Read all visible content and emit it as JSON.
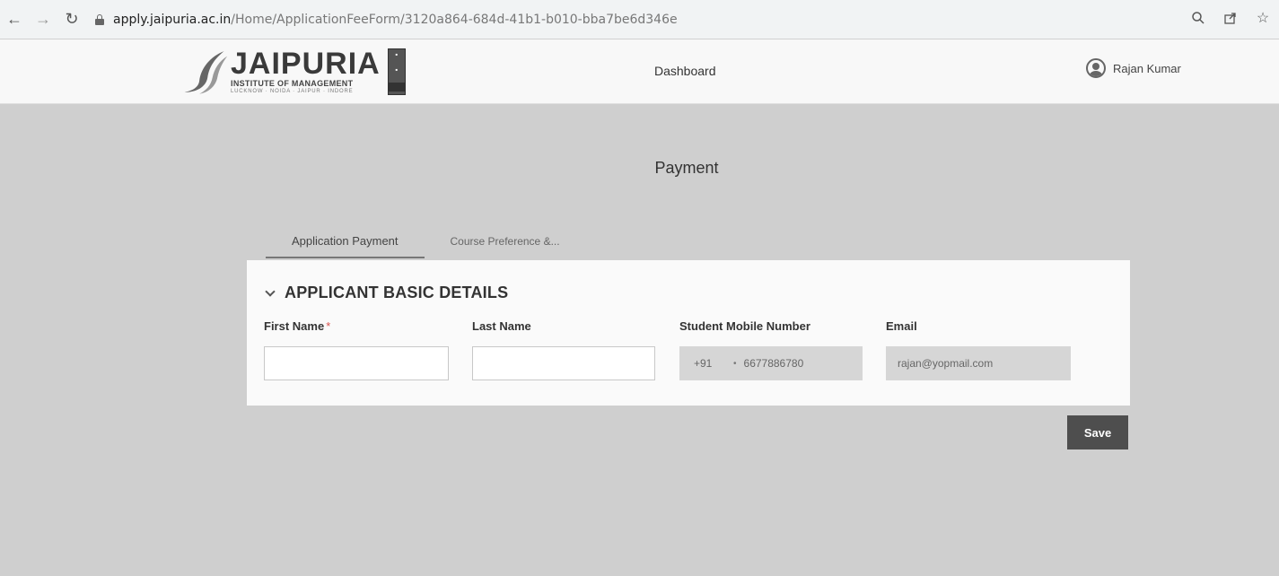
{
  "browser": {
    "url_host": "apply.jaipuria.ac.in",
    "url_path": "/Home/ApplicationFeeForm/3120a864-684d-41b1-b010-bba7be6d346e"
  },
  "header": {
    "logo": {
      "word": "JAIPURIA",
      "subtitle": "INSTITUTE OF MANAGEMENT",
      "cities": "LUCKNOW · NOIDA · JAIPUR · INDORE"
    },
    "nav_dashboard": "Dashboard",
    "user_name": "Rajan Kumar"
  },
  "main": {
    "title": "Payment",
    "tabs": [
      {
        "label": "Application Payment",
        "active": true
      },
      {
        "label": "Course Preference &...",
        "active": false
      }
    ],
    "section": {
      "title": "APPLICANT BASIC DETAILS",
      "fields": {
        "first_name": {
          "label": "First Name",
          "required_mark": "*",
          "value": ""
        },
        "last_name": {
          "label": "Last Name",
          "value": ""
        },
        "mobile": {
          "label": "Student Mobile Number",
          "code": "+91",
          "value": "6677886780"
        },
        "email": {
          "label": "Email",
          "value": "rajan@yopmail.com"
        }
      }
    },
    "save_label": "Save"
  },
  "colors": {
    "page_bg": "#cfcfcf",
    "card_bg": "#fafafa",
    "save_button": "#4e4e4e",
    "required": "#d9534f"
  }
}
